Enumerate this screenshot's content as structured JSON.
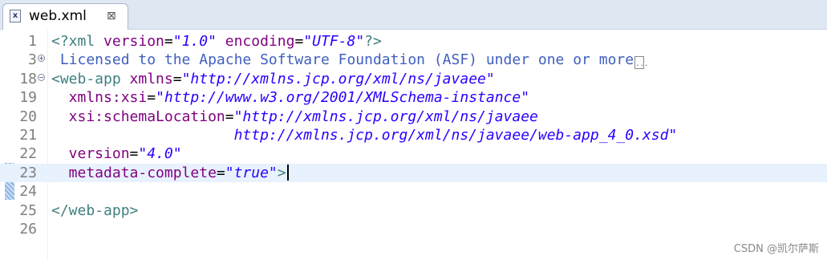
{
  "tab": {
    "icon": "xml-file-icon",
    "title": "web.xml",
    "close_glyph": "⊠"
  },
  "editor": {
    "line_numbers": [
      "1",
      "3",
      "18",
      "19",
      "20",
      "21",
      "22",
      "23",
      "24",
      "25",
      "26"
    ],
    "l1": {
      "open": "<?xml ",
      "a1": "version",
      "eq1": "=",
      "v1": "\"1.0\"",
      "a2": " encoding",
      "eq2": "=",
      "v2": "\"UTF-8\"",
      "close": "?>"
    },
    "l3": {
      "comment": " Licensed to the Apache Software Foundation (ASF) under one or more"
    },
    "l18": {
      "tag": "<web-app",
      "attr": " xmlns",
      "eq": "=",
      "val": "\"http://xmlns.jcp.org/xml/ns/javaee\""
    },
    "l19": {
      "attr": "  xmlns:xsi",
      "eq": "=",
      "val": "\"http://www.w3.org/2001/XMLSchema-instance\""
    },
    "l20": {
      "attr": "  xsi:schemaLocation",
      "eq": "=",
      "val": "\"http://xmlns.jcp.org/xml/ns/javaee"
    },
    "l21": {
      "val": "                     http://xmlns.jcp.org/xml/ns/javaee/web-app_4_0.xsd\""
    },
    "l22": {
      "attr": "  version",
      "eq": "=",
      "val": "\"4.0\""
    },
    "l23": {
      "attr": "  metadata-complete",
      "eq": "=",
      "val": "\"true\"",
      "close": ">"
    },
    "l24": {
      "text": ""
    },
    "l25": {
      "tag": "</web-app>"
    },
    "l26": {
      "text": ""
    }
  },
  "watermark": "CSDN @凯尔萨斯"
}
